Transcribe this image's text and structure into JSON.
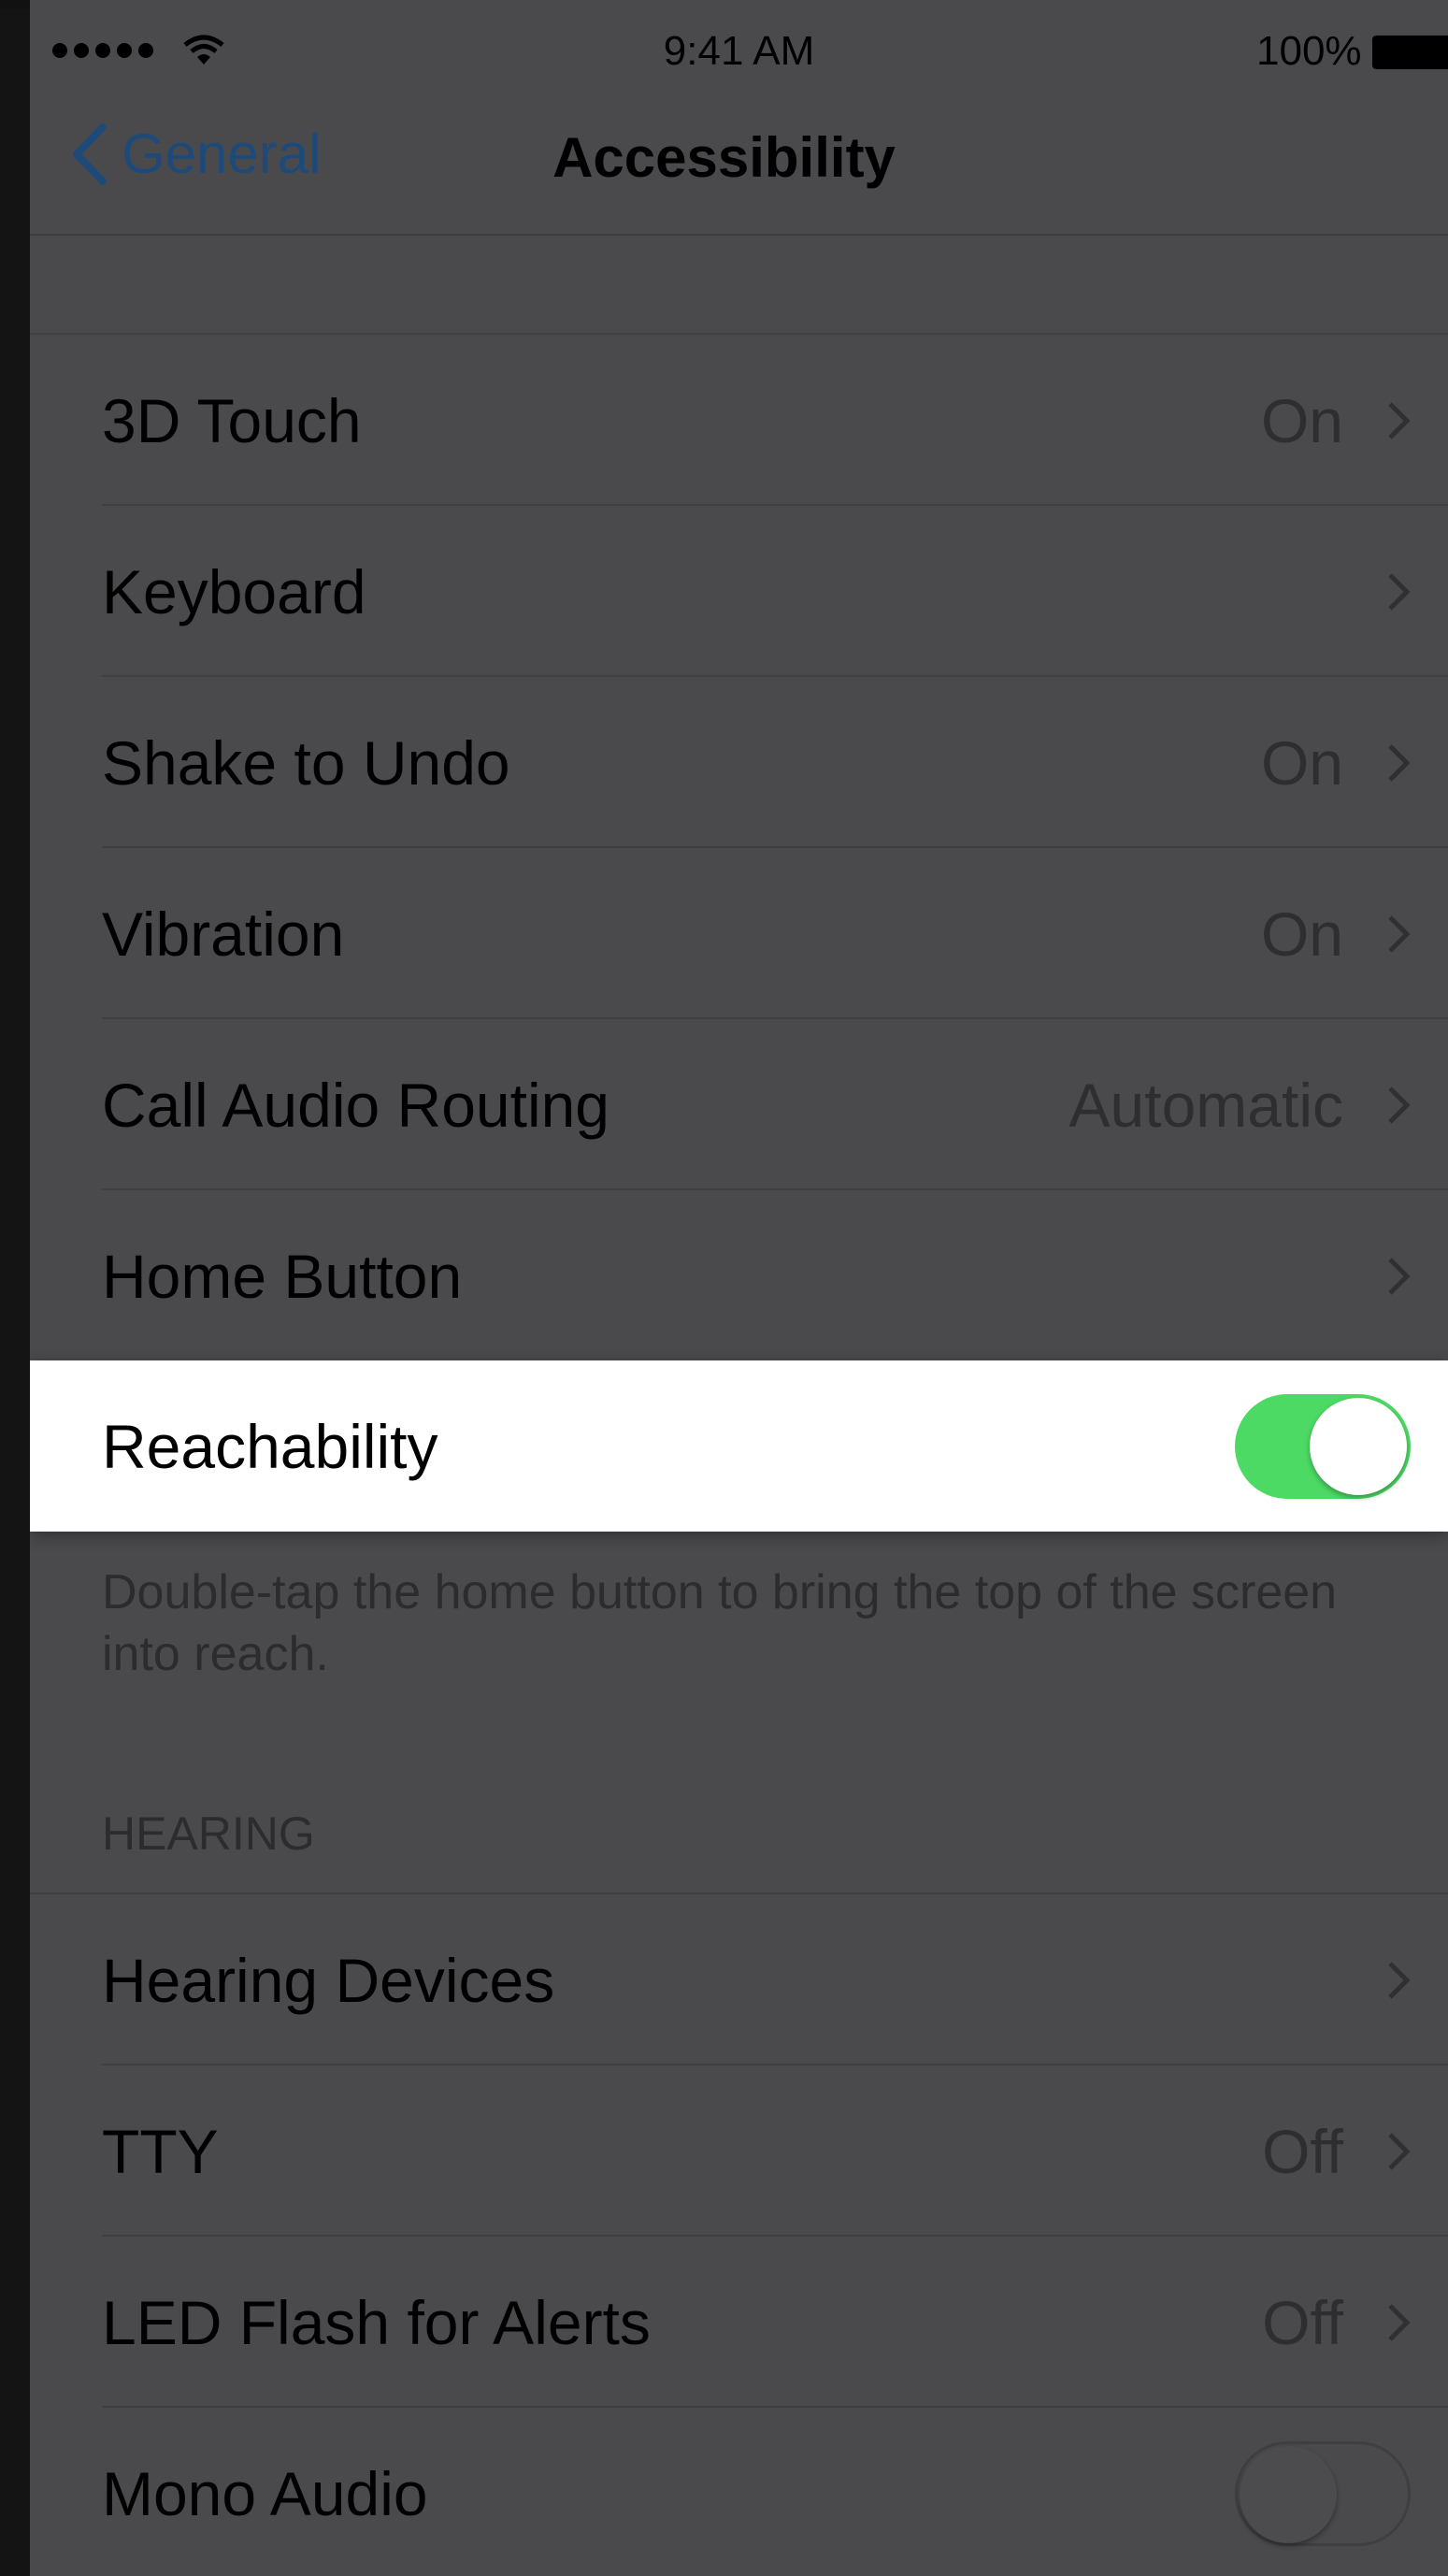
{
  "status_bar": {
    "time": "9:41 AM",
    "battery_percent": "100%",
    "signal_bars": 5,
    "icons": [
      "signal-icon",
      "wifi-icon",
      "battery-icon"
    ]
  },
  "nav": {
    "back_label": "General",
    "title": "Accessibility"
  },
  "rows_group1": [
    {
      "label": "3D Touch",
      "value": "On"
    },
    {
      "label": "Keyboard",
      "value": ""
    },
    {
      "label": "Shake to Undo",
      "value": "On"
    },
    {
      "label": "Vibration",
      "value": "On"
    },
    {
      "label": "Call Audio Routing",
      "value": "Automatic"
    },
    {
      "label": "Home Button",
      "value": ""
    }
  ],
  "reachability": {
    "label": "Reachability",
    "enabled": true,
    "footer": "Double-tap the home button to bring the top of the screen into reach."
  },
  "hearing": {
    "header": "HEARING",
    "rows": [
      {
        "label": "Hearing Devices",
        "value": ""
      },
      {
        "label": "TTY",
        "value": "Off"
      },
      {
        "label": "LED Flash for Alerts",
        "value": "Off"
      }
    ],
    "mono_audio": {
      "label": "Mono Audio",
      "enabled": false
    }
  },
  "colors": {
    "toggle_on": "#4cd964",
    "link": "#1e4a7a"
  }
}
